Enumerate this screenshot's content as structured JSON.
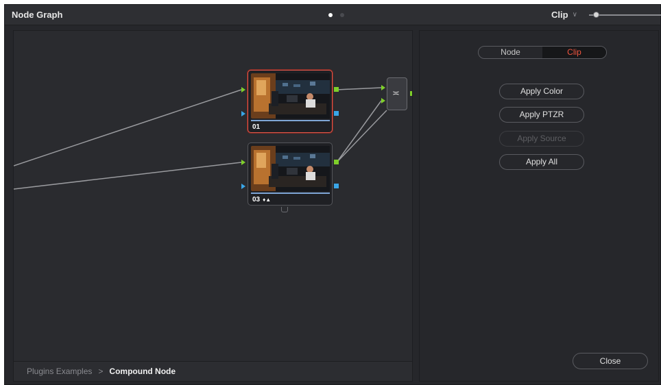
{
  "title_bar": {
    "title": "Node Graph",
    "clip_selector": "Clip",
    "page_dots": 2
  },
  "graph": {
    "nodes": [
      {
        "label": "01",
        "selected": true
      },
      {
        "label": "03",
        "indicators": "♦▲",
        "selected": false
      }
    ],
    "mixer_symbol": "≍"
  },
  "breadcrumb": {
    "parent": "Plugins Examples",
    "separator": ">",
    "current": "Compound Node"
  },
  "side_panel": {
    "segmented": {
      "options": [
        "Node",
        "Clip"
      ],
      "active": "Clip"
    },
    "buttons": [
      {
        "label": "Apply Color",
        "enabled": true
      },
      {
        "label": "Apply PTZR",
        "enabled": true
      },
      {
        "label": "Apply Source",
        "enabled": false
      },
      {
        "label": "Apply All",
        "enabled": true
      }
    ],
    "close_label": "Close"
  },
  "colors": {
    "background": "#26272b",
    "accent": "#f0553f",
    "port_rgb": "#7fcf2a",
    "port_alpha": "#3aa6e8",
    "selected_border": "#e0564a"
  }
}
